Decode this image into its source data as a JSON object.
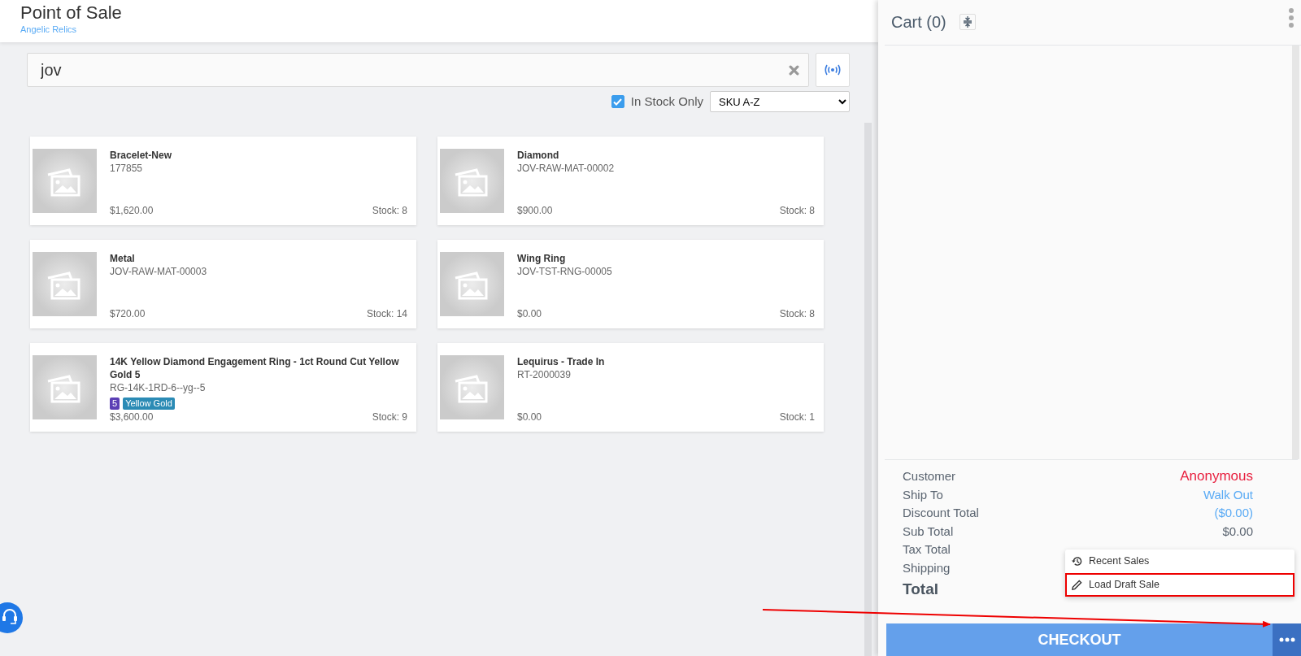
{
  "header": {
    "title": "Point of Sale",
    "subtitle": "Angelic Relics"
  },
  "search": {
    "value": "jov"
  },
  "filters": {
    "in_stock_only": {
      "label": "In Stock Only",
      "checked": true
    },
    "sort": {
      "value": "SKU A-Z"
    }
  },
  "products": [
    {
      "name": "Bracelet-New",
      "sku": "177855",
      "price": "$1,620.00",
      "stock": "Stock: 8"
    },
    {
      "name": "Diamond",
      "sku": "JOV-RAW-MAT-00002",
      "price": "$900.00",
      "stock": "Stock: 8"
    },
    {
      "name": "Metal",
      "sku": "JOV-RAW-MAT-00003",
      "price": "$720.00",
      "stock": "Stock: 14"
    },
    {
      "name": "Wing Ring",
      "sku": "JOV-TST-RNG-00005",
      "price": "$0.00",
      "stock": "Stock: 8"
    },
    {
      "name": "14K Yellow Diamond Engagement Ring - 1ct Round Cut Yellow Gold 5",
      "sku": "RG-14K-1RD-6--yg--5",
      "tags": [
        {
          "label": "5",
          "color": "#5b3fb5"
        },
        {
          "label": "Yellow Gold",
          "color": "#2b8bb5"
        }
      ],
      "price": "$3,600.00",
      "stock": "Stock: 9"
    },
    {
      "name": "Lequirus - Trade In",
      "sku": "RT-2000039",
      "price": "$0.00",
      "stock": "Stock: 1"
    }
  ],
  "cart": {
    "title": "Cart (0)",
    "summary": [
      {
        "label": "Customer",
        "value": "Anonymous",
        "kind": "customer"
      },
      {
        "label": "Ship To",
        "value": "Walk Out",
        "kind": "link"
      },
      {
        "label": "Discount Total",
        "value": "($0.00)",
        "kind": "link"
      },
      {
        "label": "Sub Total",
        "value": "$0.00",
        "kind": "plain"
      },
      {
        "label": "Tax Total",
        "kind": "plain"
      },
      {
        "label": "Shipping",
        "kind": "plain"
      },
      {
        "label": "Total",
        "kind": "total"
      }
    ],
    "checkout": {
      "label": "CHECKOUT"
    },
    "menu": [
      {
        "label": "Recent Sales",
        "kind": "recent",
        "highlighted": false
      },
      {
        "label": "Load Draft Sale",
        "kind": "draft",
        "highlighted": true
      }
    ]
  }
}
